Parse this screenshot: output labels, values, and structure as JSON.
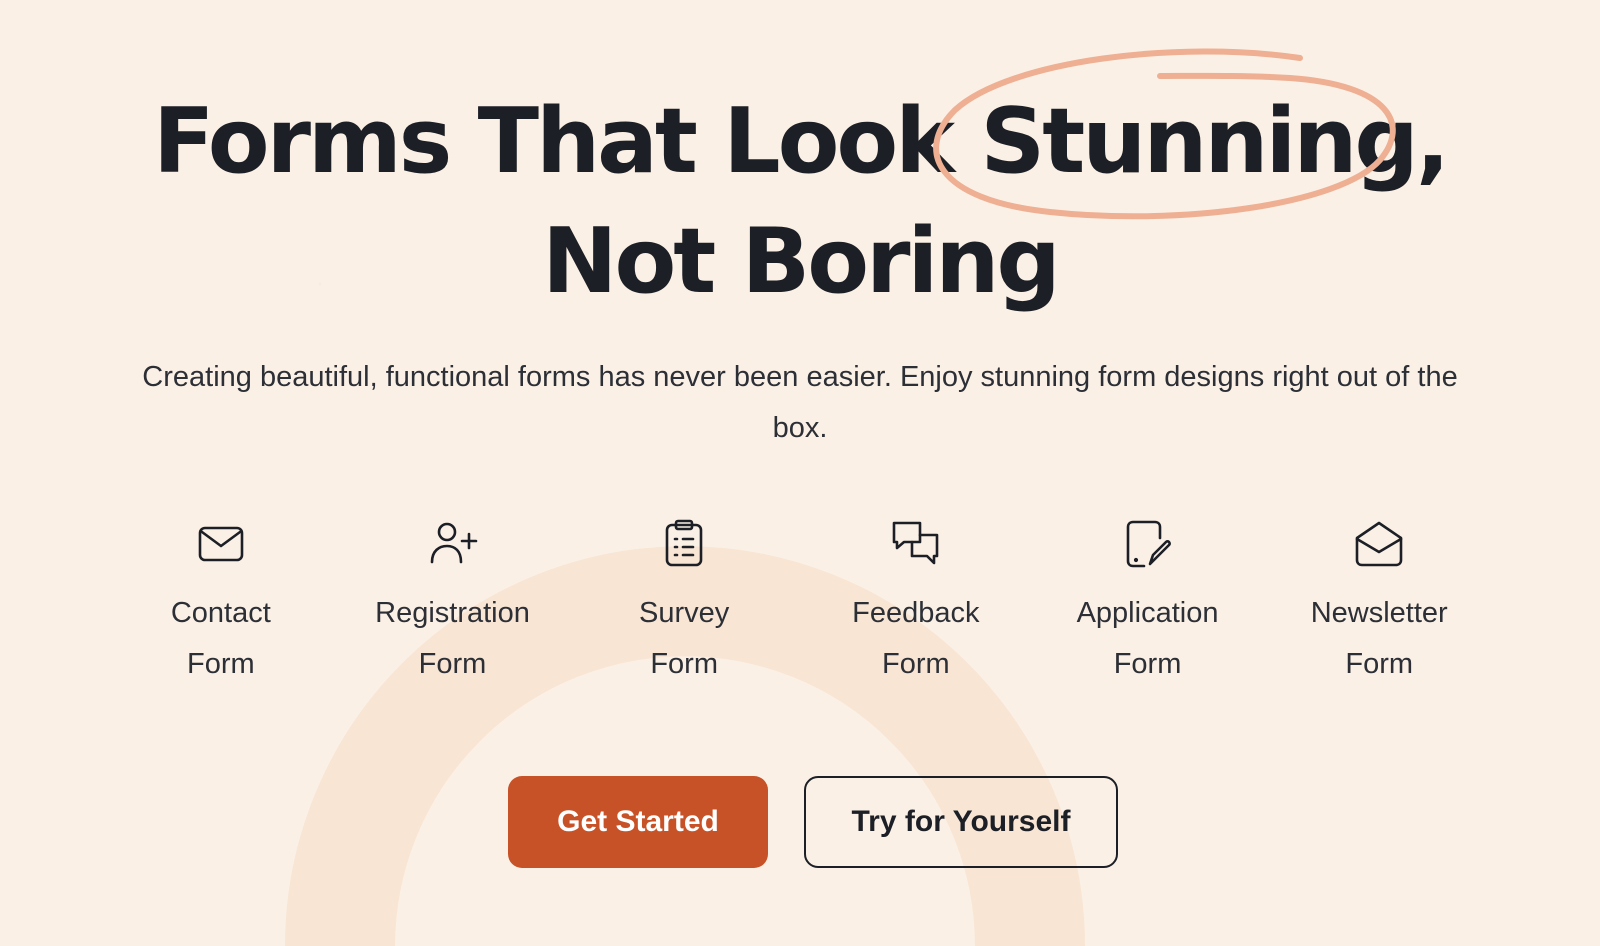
{
  "hero": {
    "headline_line1": "Forms That Look Stunning,",
    "headline_line2": "Not Boring",
    "subtitle": "Creating beautiful, functional forms has never been easier. Enjoy stunning form designs right out of the box."
  },
  "form_types": [
    {
      "icon": "envelope-icon",
      "label": "Contact\nForm"
    },
    {
      "icon": "user-plus-icon",
      "label": "Registration\nForm"
    },
    {
      "icon": "clipboard-list-icon",
      "label": "Survey\nForm"
    },
    {
      "icon": "chat-bubbles-icon",
      "label": "Feedback\nForm"
    },
    {
      "icon": "document-edit-icon",
      "label": "Application\nForm"
    },
    {
      "icon": "open-envelope-icon",
      "label": "Newsletter\nForm"
    }
  ],
  "buttons": {
    "primary_label": "Get Started",
    "secondary_label": "Try for Yourself"
  },
  "colors": {
    "background": "#fbf0e5",
    "accent": "#c85227",
    "scribble": "#eeaf93",
    "text": "#1c1f26"
  }
}
